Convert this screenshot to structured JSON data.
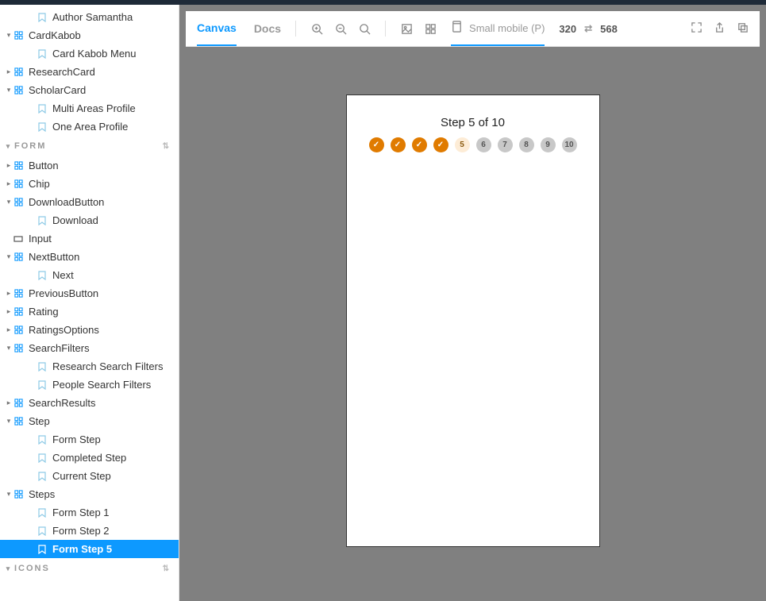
{
  "sidebar": {
    "top_items": [
      {
        "label": "Author Samantha",
        "type": "bookmark",
        "indent": 2
      },
      {
        "label": "CardKabob",
        "type": "component",
        "indent": 0,
        "caret": "open"
      },
      {
        "label": "Card Kabob Menu",
        "type": "bookmark",
        "indent": 2
      },
      {
        "label": "ResearchCard",
        "type": "component",
        "indent": 0,
        "caret": "closed"
      },
      {
        "label": "ScholarCard",
        "type": "component",
        "indent": 0,
        "caret": "open"
      },
      {
        "label": "Multi Areas Profile",
        "type": "bookmark",
        "indent": 2
      },
      {
        "label": "One Area Profile",
        "type": "bookmark",
        "indent": 2
      }
    ],
    "form_header": "FORM",
    "form_items": [
      {
        "label": "Button",
        "type": "component",
        "indent": 0,
        "caret": "closed"
      },
      {
        "label": "Chip",
        "type": "component",
        "indent": 0,
        "caret": "closed"
      },
      {
        "label": "DownloadButton",
        "type": "component",
        "indent": 0,
        "caret": "open"
      },
      {
        "label": "Download",
        "type": "bookmark",
        "indent": 2
      },
      {
        "label": "Input",
        "type": "input",
        "indent": 0,
        "caret": "none"
      },
      {
        "label": "NextButton",
        "type": "component",
        "indent": 0,
        "caret": "open"
      },
      {
        "label": "Next",
        "type": "bookmark",
        "indent": 2
      },
      {
        "label": "PreviousButton",
        "type": "component",
        "indent": 0,
        "caret": "closed"
      },
      {
        "label": "Rating",
        "type": "component",
        "indent": 0,
        "caret": "closed"
      },
      {
        "label": "RatingsOptions",
        "type": "component",
        "indent": 0,
        "caret": "closed"
      },
      {
        "label": "SearchFilters",
        "type": "component",
        "indent": 0,
        "caret": "open"
      },
      {
        "label": "Research Search Filters",
        "type": "bookmark",
        "indent": 2
      },
      {
        "label": "People Search Filters",
        "type": "bookmark",
        "indent": 2
      },
      {
        "label": "SearchResults",
        "type": "component",
        "indent": 0,
        "caret": "closed"
      },
      {
        "label": "Step",
        "type": "component",
        "indent": 0,
        "caret": "open"
      },
      {
        "label": "Form Step",
        "type": "bookmark",
        "indent": 2
      },
      {
        "label": "Completed Step",
        "type": "bookmark",
        "indent": 2
      },
      {
        "label": "Current Step",
        "type": "bookmark",
        "indent": 2
      },
      {
        "label": "Steps",
        "type": "component",
        "indent": 0,
        "caret": "open"
      },
      {
        "label": "Form Step 1",
        "type": "bookmark",
        "indent": 2
      },
      {
        "label": "Form Step 2",
        "type": "bookmark",
        "indent": 2
      },
      {
        "label": "Form Step 5",
        "type": "bookmark",
        "indent": 2,
        "selected": true
      }
    ],
    "icons_header": "ICONS"
  },
  "toolbar": {
    "tabs": {
      "canvas": "Canvas",
      "docs": "Docs"
    },
    "viewport_label": "Small mobile (P)",
    "width": "320",
    "height": "568"
  },
  "preview": {
    "title": "Step 5 of 10",
    "steps": [
      {
        "state": "done",
        "label": "✓"
      },
      {
        "state": "done",
        "label": "✓"
      },
      {
        "state": "done",
        "label": "✓"
      },
      {
        "state": "done",
        "label": "✓"
      },
      {
        "state": "current",
        "label": "5"
      },
      {
        "state": "future",
        "label": "6"
      },
      {
        "state": "future",
        "label": "7"
      },
      {
        "state": "future",
        "label": "8"
      },
      {
        "state": "future",
        "label": "9"
      },
      {
        "state": "future",
        "label": "10"
      }
    ]
  }
}
